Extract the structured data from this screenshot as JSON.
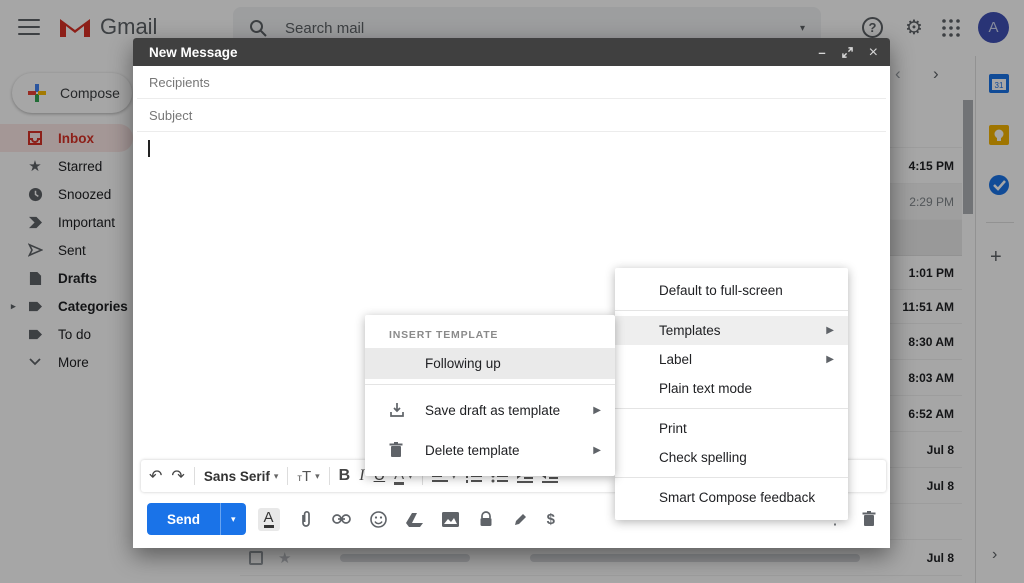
{
  "colors": {
    "accent": "#1a73e8",
    "inbox-red": "#d93025",
    "inbox-bg": "#fce8e6",
    "keep-yellow": "#f5b400",
    "avatar-indigo": "#3f51b5",
    "header-dark": "#404040"
  },
  "icons": {
    "undo": "↶",
    "redo": "↷",
    "caret": "▾",
    "minimize": "–",
    "close": "×",
    "star": "★",
    "dollar": "$",
    "more_vert": "⋮",
    "plus": "+",
    "chevron_left": "‹",
    "chevron_right": "›",
    "help": "?",
    "gear": "⚙",
    "menu_arrow": "▶",
    "side_caret": "▸"
  },
  "topbar": {
    "logo_text": "Gmail",
    "search_placeholder": "Search mail",
    "avatar_letter": "A"
  },
  "sidebar": {
    "compose_label": "Compose",
    "items": [
      {
        "label": "Inbox"
      },
      {
        "label": "Starred"
      },
      {
        "label": "Snoozed"
      },
      {
        "label": "Important"
      },
      {
        "label": "Sent"
      },
      {
        "label": "Drafts"
      },
      {
        "label": "Categories"
      },
      {
        "label": "To do"
      },
      {
        "label": "More"
      }
    ]
  },
  "compose": {
    "title": "New Message",
    "recipients_placeholder": "Recipients",
    "subject_placeholder": "Subject",
    "font_name": "Sans Serif",
    "send_label": "Send"
  },
  "options_menu": {
    "items": [
      {
        "label": "Default to full-screen"
      },
      {
        "label": "Templates"
      },
      {
        "label": "Label"
      },
      {
        "label": "Plain text mode"
      },
      {
        "label": "Print"
      },
      {
        "label": "Check spelling"
      },
      {
        "label": "Smart Compose feedback"
      }
    ]
  },
  "template_menu": {
    "header": "INSERT TEMPLATE",
    "template_name": "Following up",
    "save_label": "Save draft as template",
    "delete_label": "Delete template"
  },
  "email_list": {
    "rows": [
      {
        "time": "4:15 PM"
      },
      {
        "time": "2:29 PM"
      },
      {
        "time": "1:01 PM"
      },
      {
        "time": "11:51 AM"
      },
      {
        "time": "8:30 AM"
      },
      {
        "time": "8:03 AM"
      },
      {
        "time": "6:52 AM"
      },
      {
        "time": "Jul 8"
      },
      {
        "time": "Jul 8"
      }
    ],
    "bottom_row": {
      "time": "Jul 8"
    }
  }
}
